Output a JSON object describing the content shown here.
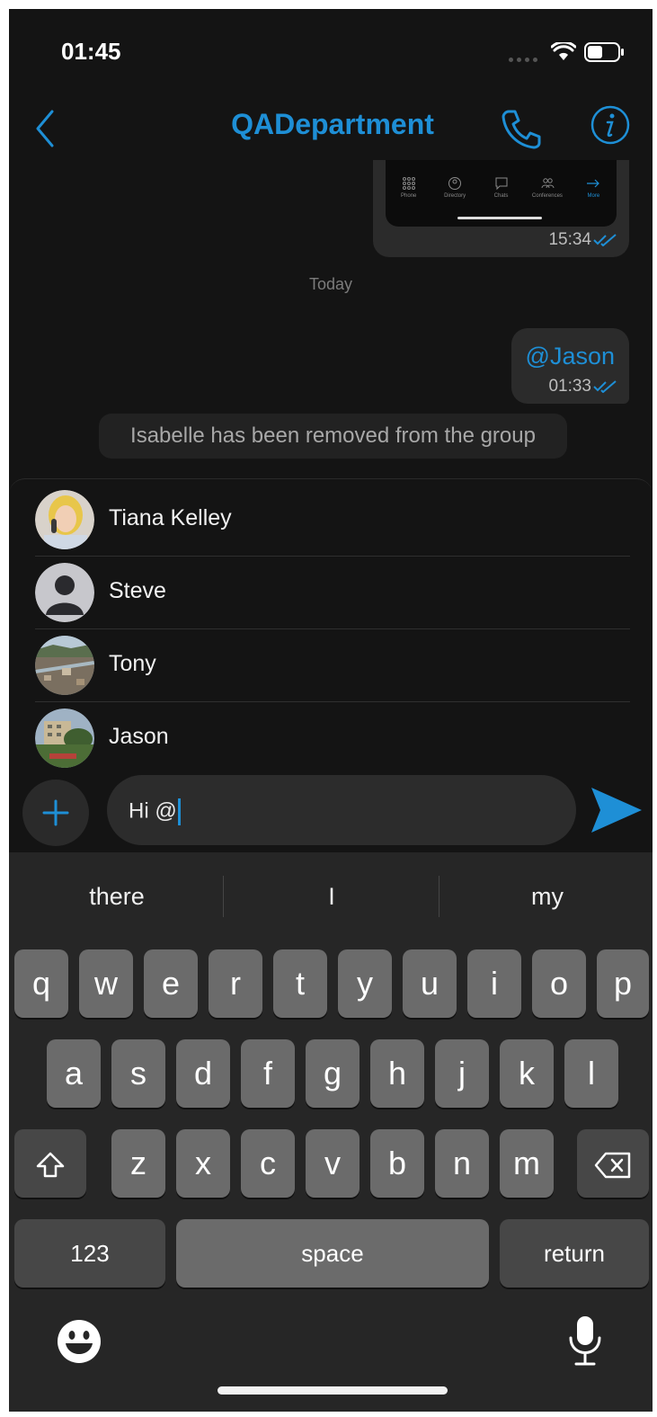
{
  "status_bar": {
    "time": "01:45"
  },
  "header": {
    "title": "QADepartment"
  },
  "chat": {
    "image_message": {
      "tabs": [
        {
          "label": "Phone",
          "icon": "dial-pad-icon"
        },
        {
          "label": "Directory",
          "icon": "directory-icon"
        },
        {
          "label": "Chats",
          "icon": "chat-icon"
        },
        {
          "label": "Conferences",
          "icon": "conferences-icon"
        },
        {
          "label": "More",
          "icon": "arrow-right-icon"
        }
      ],
      "time": "15:34"
    },
    "date_separator": "Today",
    "outgoing_message": {
      "text": "@Jason",
      "time": "01:33"
    },
    "system_message": "Isabelle has been removed from the group"
  },
  "mention_list": [
    {
      "name": "Tiana Kelley"
    },
    {
      "name": "Steve"
    },
    {
      "name": "Tony"
    },
    {
      "name": "Jason"
    }
  ],
  "composer": {
    "text": "Hi @"
  },
  "keyboard": {
    "suggestions": [
      "there",
      "I",
      "my"
    ],
    "row1": [
      "q",
      "w",
      "e",
      "r",
      "t",
      "y",
      "u",
      "i",
      "o",
      "p"
    ],
    "row2": [
      "a",
      "s",
      "d",
      "f",
      "g",
      "h",
      "j",
      "k",
      "l"
    ],
    "row3": [
      "z",
      "x",
      "c",
      "v",
      "b",
      "n",
      "m"
    ],
    "numbers_label": "123",
    "space_label": "space",
    "return_label": "return"
  },
  "colors": {
    "accent": "#1e8fd6",
    "background": "#141414",
    "bubble": "#2b2b2b"
  }
}
